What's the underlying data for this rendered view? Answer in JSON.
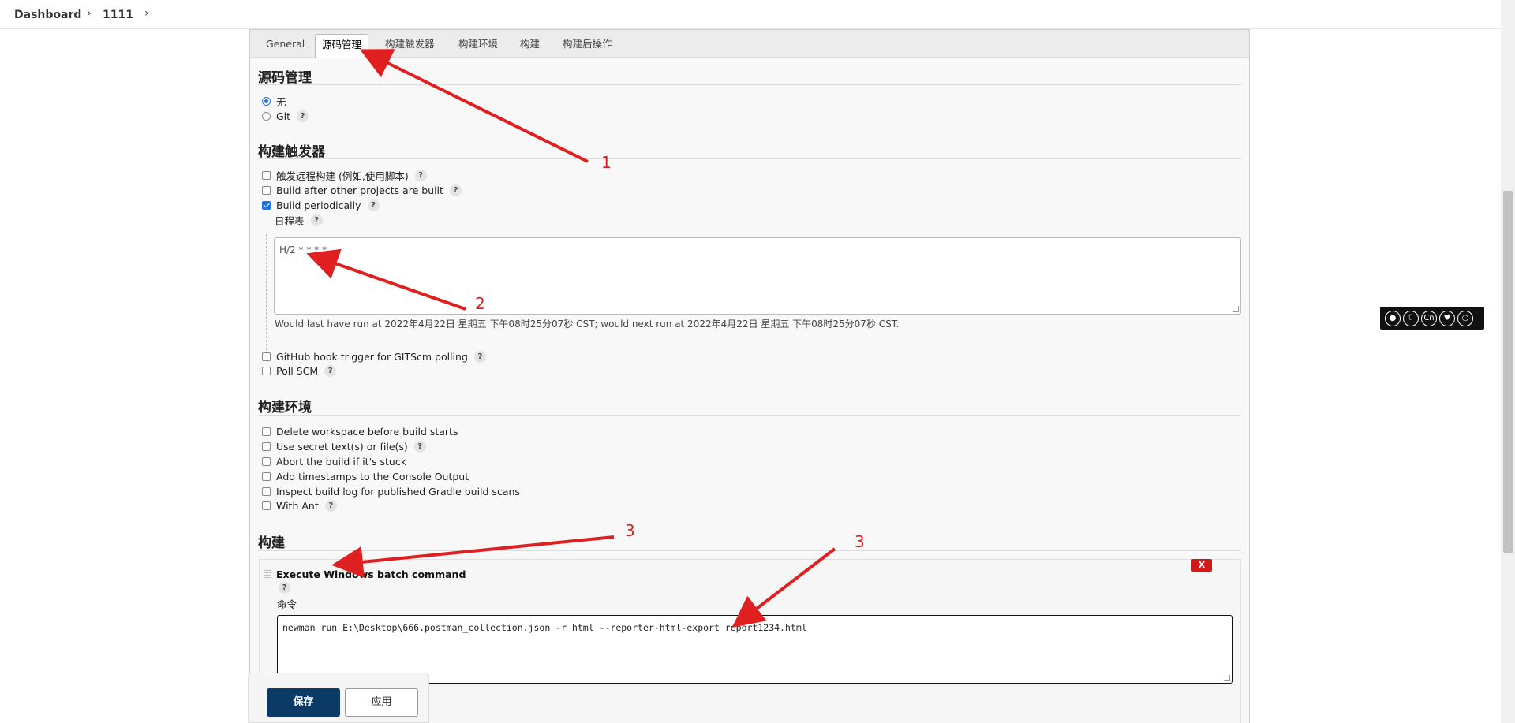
{
  "breadcrumb": {
    "items": [
      "Dashboard",
      "1111"
    ]
  },
  "tabs": [
    {
      "label": "General",
      "active": false
    },
    {
      "label": "源码管理",
      "active": true
    },
    {
      "label": "构建触发器",
      "active": false
    },
    {
      "label": "构建环境",
      "active": false
    },
    {
      "label": "构建",
      "active": false
    },
    {
      "label": "构建后操作",
      "active": false
    }
  ],
  "scm": {
    "title": "源码管理",
    "options": [
      {
        "label": "无",
        "checked": true,
        "help": false
      },
      {
        "label": "Git",
        "checked": false,
        "help": true
      }
    ]
  },
  "triggers": {
    "title": "构建触发器",
    "options_top": [
      {
        "label": "触发远程构建 (例如,使用脚本)",
        "checked": false
      },
      {
        "label": "Build after other projects are built",
        "checked": false
      },
      {
        "label": "Build periodically",
        "checked": true
      }
    ],
    "schedule_label": "日程表",
    "schedule_value": "H/2 * * * *",
    "schedule_note": "Would last have run at 2022年4月22日 星期五 下午08时25分07秒 CST; would next run at 2022年4月22日 星期五 下午08时25分07秒 CST.",
    "options_bottom": [
      {
        "label": "GitHub hook trigger for GITScm polling",
        "checked": false
      },
      {
        "label": "Poll SCM",
        "checked": false
      }
    ]
  },
  "environment": {
    "title": "构建环境",
    "options": [
      {
        "label": "Delete workspace before build starts",
        "help": false
      },
      {
        "label": "Use secret text(s) or file(s)",
        "help": true
      },
      {
        "label": "Abort the build if it's stuck",
        "help": false
      },
      {
        "label": "Add timestamps to the Console Output",
        "help": false
      },
      {
        "label": "Inspect build log for published Gradle build scans",
        "help": false
      },
      {
        "label": "With Ant",
        "help": true
      }
    ]
  },
  "build": {
    "title": "构建",
    "step_title": "Execute Windows batch command",
    "command_label": "命令",
    "command_value": "newman run E:\\Desktop\\666.postman_collection.json -r html --reporter-html-export report1234.html",
    "delete_label": "X"
  },
  "actions": {
    "save": "保存",
    "apply": "应用"
  },
  "help_glyph": "?",
  "annotations": [
    "1",
    "2",
    "3",
    "3"
  ],
  "colors": {
    "accent": "#1a73e8",
    "save": "#0b3a66",
    "delete": "#d01a1a",
    "annotation": "#e02020"
  }
}
